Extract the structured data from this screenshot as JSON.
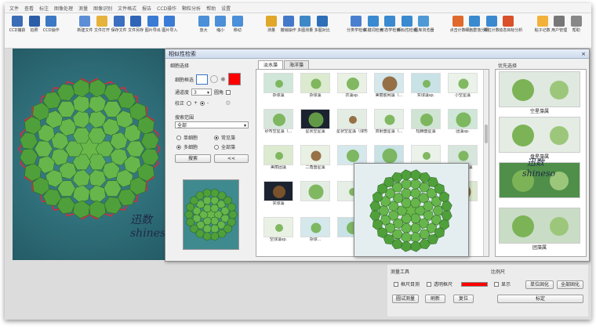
{
  "menu": [
    "文件",
    "查看",
    "标注",
    "图像处理",
    "测量",
    "图像识别",
    "文件格式",
    "报告",
    "CCD操作",
    "颗粒分析",
    "帮助",
    "设置"
  ],
  "toolbar": [
    {
      "label": "CCD捕获",
      "icon": "camera-ccd-icon",
      "color": "#3a6db5"
    },
    {
      "label": "拍照",
      "icon": "camera-icon",
      "color": "#2c5ea8"
    },
    {
      "label": "CCD操作",
      "icon": "monitor-icon",
      "color": "#3c78c4"
    },
    {
      "label": "新建文件",
      "icon": "new-file-icon",
      "color": "#5b8ed6"
    },
    {
      "label": "文件打开",
      "icon": "folder-open-icon",
      "color": "#e5b33c"
    },
    {
      "label": "保存文件",
      "icon": "save-icon",
      "color": "#3b6fc0"
    },
    {
      "label": "文件另存",
      "icon": "save-as-icon",
      "color": "#2f65b8"
    },
    {
      "label": "图片导出",
      "icon": "image-export-icon",
      "color": "#3a7bd5"
    },
    {
      "label": "图片导入",
      "icon": "image-import-icon",
      "color": "#3a7bd5"
    },
    {
      "label": "放大",
      "icon": "zoom-in-icon",
      "color": "#4a8fd8"
    },
    {
      "label": "缩小",
      "icon": "zoom-out-icon",
      "color": "#4a8fd8"
    },
    {
      "label": "移动",
      "icon": "move-icon",
      "color": "#4a8fd8"
    },
    {
      "label": "测量",
      "icon": "ruler-icon",
      "color": "#e0a72a"
    },
    {
      "label": "撤销操作",
      "icon": "undo-icon",
      "color": "#4478c8"
    },
    {
      "label": "多图测量",
      "icon": "multi-measure-icon",
      "color": "#3f88c8"
    },
    {
      "label": "多图对比",
      "icon": "compare-icon",
      "color": "#2e6fb7"
    },
    {
      "label": "分类学检索",
      "icon": "grid-search-icon",
      "color": "#4a7fd0"
    },
    {
      "label": "关键词检索",
      "icon": "keyword-search-icon",
      "color": "#3a8ad0"
    },
    {
      "label": "形态学检索",
      "icon": "shape-search-icon",
      "color": "#3a8ad0"
    },
    {
      "label": "相似性检索",
      "icon": "similar-search-icon",
      "color": "#3a8ad0"
    },
    {
      "label": "图库浏览器",
      "icon": "gallery-icon",
      "color": "#4f9ad6"
    },
    {
      "label": "点击计数",
      "icon": "count-icon",
      "color": "#e06a2c"
    },
    {
      "label": "细胞群落分析",
      "icon": "cell-analysis-icon",
      "color": "#3a8ad0"
    },
    {
      "label": "颗粒计数",
      "icon": "particle-icon",
      "color": "#3a8ad0"
    },
    {
      "label": "动态目标分析",
      "icon": "target-icon",
      "color": "#d9502a"
    },
    {
      "label": "粘子记数",
      "icon": "sticky-icon",
      "color": "#f2b13a"
    },
    {
      "label": "用户管理",
      "icon": "user-icon",
      "color": "#777777"
    },
    {
      "label": "帮助",
      "icon": "help-icon",
      "color": "#888888"
    }
  ],
  "dialog": {
    "title": "相似性检索",
    "close": "×",
    "cell_choice": {
      "label": "细胞选择",
      "row_label": "细胞框选",
      "pass_label": "通道度",
      "pass_value": "3",
      "circle_label": "圆角",
      "correct_label": "校正",
      "plus": "+",
      "minus": "-"
    },
    "search_scope": {
      "label": "搜索范围",
      "scope_value": "全部",
      "options": [
        {
          "label": "单细胞",
          "on": false
        },
        {
          "label": "常见藻",
          "on": true
        },
        {
          "label": "多细胞",
          "on": true
        },
        {
          "label": "全部藻",
          "on": false
        }
      ],
      "search_button": "搜索",
      "back_button": "<<"
    },
    "tabs": [
      {
        "label": "淡水藻",
        "active": true
      },
      {
        "label": "海洋藻",
        "active": false
      }
    ],
    "results": [
      "杂球藻",
      "杂球藻",
      "衣藻sp.",
      "美丽胶网藻（...",
      "实球藻sp.",
      "小空星藻",
      "砂布空星藻（...",
      "星状空星藻",
      "星状空星藻（球形...",
      "双射盘星藻（...",
      "短棘盘星藻",
      "团藻sp.",
      "美丽团藻",
      "二角盘星藻",
      "",
      "",
      "",
      "微小四球藻",
      "实球藻",
      "",
      "",
      "",
      "",
      "球团藻",
      "空球藻sp.",
      "杂球...",
      "",
      "",
      ""
    ],
    "right_title": "优先选择",
    "right_items": [
      "空星藻属",
      "盘星藻属",
      "",
      "团藻属"
    ]
  },
  "measure_tools": {
    "title": "测量工具",
    "frame_label": "框尺目测",
    "transparent_label": "透明框尺",
    "line_color": "#ff0000",
    "buttons": [
      "圆试测量",
      "刷新",
      "复位"
    ]
  },
  "scale": {
    "title": "比例尺",
    "show_label": "显示",
    "buttons": [
      "单位固化",
      "全部固化",
      "标定"
    ]
  },
  "watermark": {
    "cn": "迅数",
    "en": "shineso"
  }
}
